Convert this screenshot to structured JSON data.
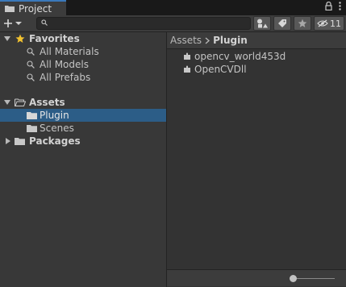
{
  "window": {
    "tab_title": "Project"
  },
  "toolbar": {
    "search_value": "",
    "hidden_count": "11",
    "icons": [
      "plus-icon",
      "dropdown-arrow-icon",
      "search-icon",
      "filter-by-type-icon",
      "filter-by-label-icon",
      "favorite-star-icon",
      "hidden-packages-icon"
    ]
  },
  "tree": {
    "favorites": {
      "label": "Favorites",
      "items": [
        "All Materials",
        "All Models",
        "All Prefabs"
      ]
    },
    "assets": {
      "label": "Assets",
      "children": [
        "Plugin",
        "Scenes"
      ],
      "selected": "Plugin"
    },
    "packages": {
      "label": "Packages"
    }
  },
  "browser": {
    "breadcrumb_root": "Assets",
    "breadcrumb_current": "Plugin",
    "files": [
      "opencv_world453d",
      "OpenCVDll"
    ]
  },
  "footer": {
    "zoom_level": 0.0
  },
  "colors": {
    "accent_tab": "#3a79bb",
    "selection": "#2c5d87",
    "favorite_star": "#f2c230"
  }
}
